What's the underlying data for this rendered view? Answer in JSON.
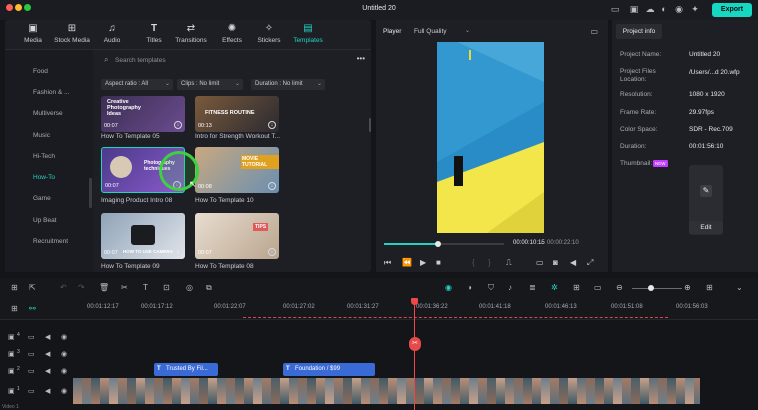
{
  "window": {
    "title": "Untitled 20",
    "export_label": "Export"
  },
  "colors": {
    "accent": "#22d3c5",
    "export_bg": "#15d7c2",
    "playhead": "#f04848",
    "title_clip": "#3a6ad6"
  },
  "tabs": [
    {
      "label": "Media",
      "icon": "media-icon"
    },
    {
      "label": "Stock Media",
      "icon": "stock-media-icon"
    },
    {
      "label": "Audio",
      "icon": "audio-icon"
    },
    {
      "label": "Titles",
      "icon": "titles-icon"
    },
    {
      "label": "Transitions",
      "icon": "transitions-icon"
    },
    {
      "label": "Effects",
      "icon": "effects-icon"
    },
    {
      "label": "Stickers",
      "icon": "stickers-icon"
    },
    {
      "label": "Templates",
      "icon": "templates-icon",
      "active": true
    }
  ],
  "sidebar": {
    "items": [
      "Food",
      "Fashion & ...",
      "Multiverse",
      "Music",
      "Hi-Tech",
      "How-To",
      "Game",
      "Up Beat",
      "Recruitment"
    ],
    "active": "How-To"
  },
  "search": {
    "placeholder": "Search templates"
  },
  "filters": [
    "Aspect ratio : All",
    "Clips : No limit",
    "Duration : No limit"
  ],
  "templates": [
    {
      "title": "How To Template 05",
      "duration": "00:07",
      "overlay": "Creative Photography Ideas"
    },
    {
      "title": "Intro for Strength Workout T...",
      "duration": "00:13",
      "overlay": "FITNESS ROUTINE"
    },
    {
      "title": "Imaging Product Intro 08",
      "duration": "00:07",
      "overlay": "Photography techniques"
    },
    {
      "title": "How To Template 10",
      "duration": "00:08",
      "overlay": "MOVIE TUTORIAL"
    },
    {
      "title": "How To Template 09",
      "duration": "00:07",
      "overlay": "HOW TO USE CAMERA"
    },
    {
      "title": "How To Template 08",
      "duration": "00:07",
      "overlay": "TIPS"
    }
  ],
  "player": {
    "tab": "Player",
    "quality": "Full Quality",
    "current_time": "00:00:10:15",
    "separator": "/",
    "total_time": "00:00:22:10",
    "progress": 0.45
  },
  "project_info": {
    "tab": "Project info",
    "fields": [
      {
        "key": "Project Name:",
        "value": "Untitled 20"
      },
      {
        "key": "Project Files Location:",
        "value": "/Users/...d 20.wfp"
      },
      {
        "key": "Resolution:",
        "value": "1080 x 1920"
      },
      {
        "key": "Frame Rate:",
        "value": "29.97fps"
      },
      {
        "key": "Color Space:",
        "value": "SDR - Rec.709"
      },
      {
        "key": "Duration:",
        "value": "00:01:56:10"
      }
    ],
    "thumbnail_label": "Thumbnail:",
    "new_badge": "NEW",
    "edit_label": "Edit"
  },
  "timeline": {
    "ruler_times": [
      "00:01:12:17",
      "00:01:17:12",
      "00:01:22:07",
      "00:01:27:02",
      "00:01:31:27",
      "00:01:36:22",
      "00:01:41:18",
      "00:01:46:13",
      "00:01:51:08",
      "00:01:56:03"
    ],
    "title_clips": [
      "Trusted By Fil...",
      "Foundation / $99"
    ],
    "title_clip_icon": "T",
    "track_labels": [
      "4",
      "3",
      "2",
      "1"
    ],
    "video_label": "Video 1"
  }
}
